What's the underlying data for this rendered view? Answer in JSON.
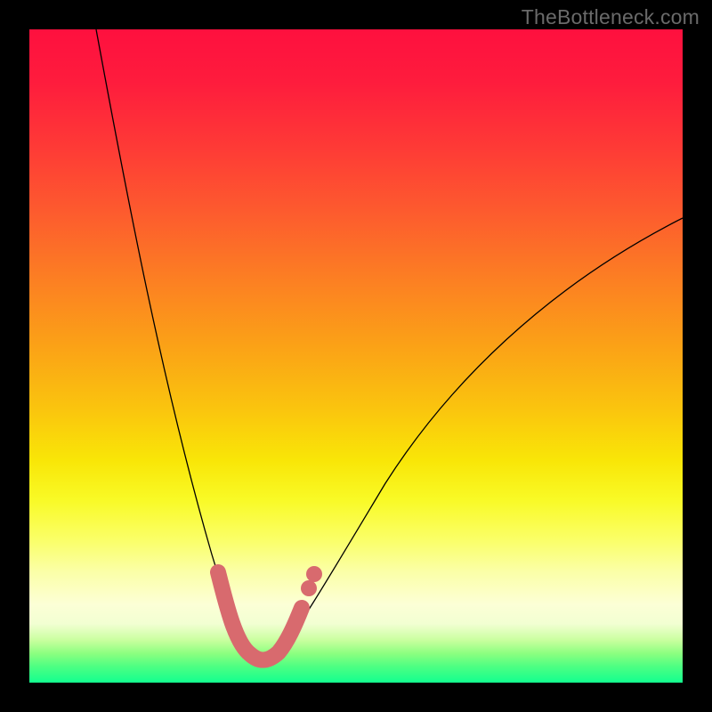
{
  "watermark": "TheBottleneck.com",
  "colors": {
    "background": "#000000",
    "watermark_text": "#6a6a6a",
    "curve": "#000000",
    "marker": "#d86a6e",
    "gradient_top": "#fe103e",
    "gradient_bottom": "#13ff8f"
  },
  "chart_data": {
    "type": "line",
    "title": "",
    "xlabel": "",
    "ylabel": "",
    "xlim": [
      0,
      100
    ],
    "ylim": [
      0,
      100
    ],
    "series": [
      {
        "name": "bottleneck-curve",
        "x": [
          10,
          12,
          14,
          16,
          18,
          20,
          22,
          24,
          26,
          28,
          30,
          31,
          32,
          33,
          34,
          35,
          36,
          37,
          38,
          40,
          44,
          48,
          52,
          56,
          60,
          66,
          72,
          78,
          84,
          90,
          96,
          100
        ],
        "values": [
          100,
          90,
          80,
          70,
          61,
          52,
          44,
          36,
          29,
          22,
          15,
          12,
          9,
          6,
          4,
          3,
          3,
          4,
          6,
          9,
          16,
          23,
          29,
          35,
          40,
          47,
          53,
          58,
          62,
          66,
          69,
          71
        ]
      },
      {
        "name": "highlight-segment",
        "x": [
          30,
          31,
          32,
          33,
          34,
          35,
          36,
          37,
          38,
          40
        ],
        "values": [
          15,
          12,
          9,
          6,
          4,
          3,
          3,
          4,
          6,
          9
        ]
      }
    ],
    "note": "Axis values are estimated from pixel positions; the chart has no tick labels, so x and y are normalized 0–100 across the gradient square. Lower values correspond to less bottleneck."
  }
}
